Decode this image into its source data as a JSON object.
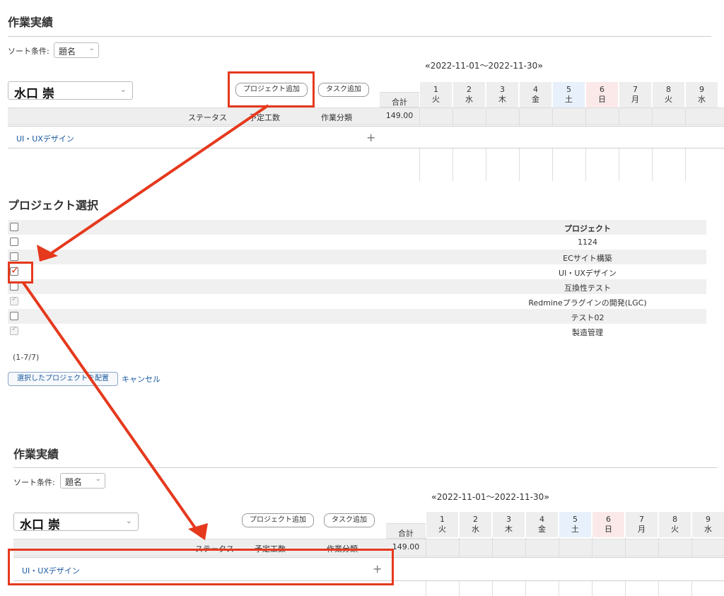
{
  "top": {
    "title": "作業実績",
    "sort_label": "ソート条件:",
    "sort_value": "題名",
    "date_range": "2022-11-01〜2022-11-30",
    "prev_arrow": "«",
    "next_arrow": "»",
    "user": "水口 崇",
    "add_project_btn": "プロジェクト追加",
    "add_task_btn": "タスク追加",
    "col_status": "ステータス",
    "col_planned": "予定工数",
    "col_category": "作業分類",
    "total_label": "合計",
    "total_value": "149.00",
    "row_project": "UI・UXデザイン",
    "days": [
      {
        "d": "1",
        "w": "火"
      },
      {
        "d": "2",
        "w": "水"
      },
      {
        "d": "3",
        "w": "木"
      },
      {
        "d": "4",
        "w": "金"
      },
      {
        "d": "5",
        "w": "土"
      },
      {
        "d": "6",
        "w": "日"
      },
      {
        "d": "7",
        "w": "月"
      },
      {
        "d": "8",
        "w": "火"
      },
      {
        "d": "9",
        "w": "水"
      }
    ]
  },
  "select": {
    "title": "プロジェクト選択",
    "header": "プロジェクト",
    "projects": [
      {
        "name": "1124",
        "state": "unchecked"
      },
      {
        "name": "ECサイト構築",
        "state": "unchecked"
      },
      {
        "name": "UI・UXデザイン",
        "state": "checked"
      },
      {
        "name": "互換性テスト",
        "state": "unchecked"
      },
      {
        "name": "Redmineプラグインの開発(LGC)",
        "state": "disabled"
      },
      {
        "name": "テスト02",
        "state": "unchecked"
      },
      {
        "name": "製造管理",
        "state": "disabled"
      }
    ],
    "count": "(1-7/7)",
    "submit_btn": "選択したプロジェクトを配置",
    "cancel": "キャンセル"
  },
  "annotation_color": "#e5391d"
}
